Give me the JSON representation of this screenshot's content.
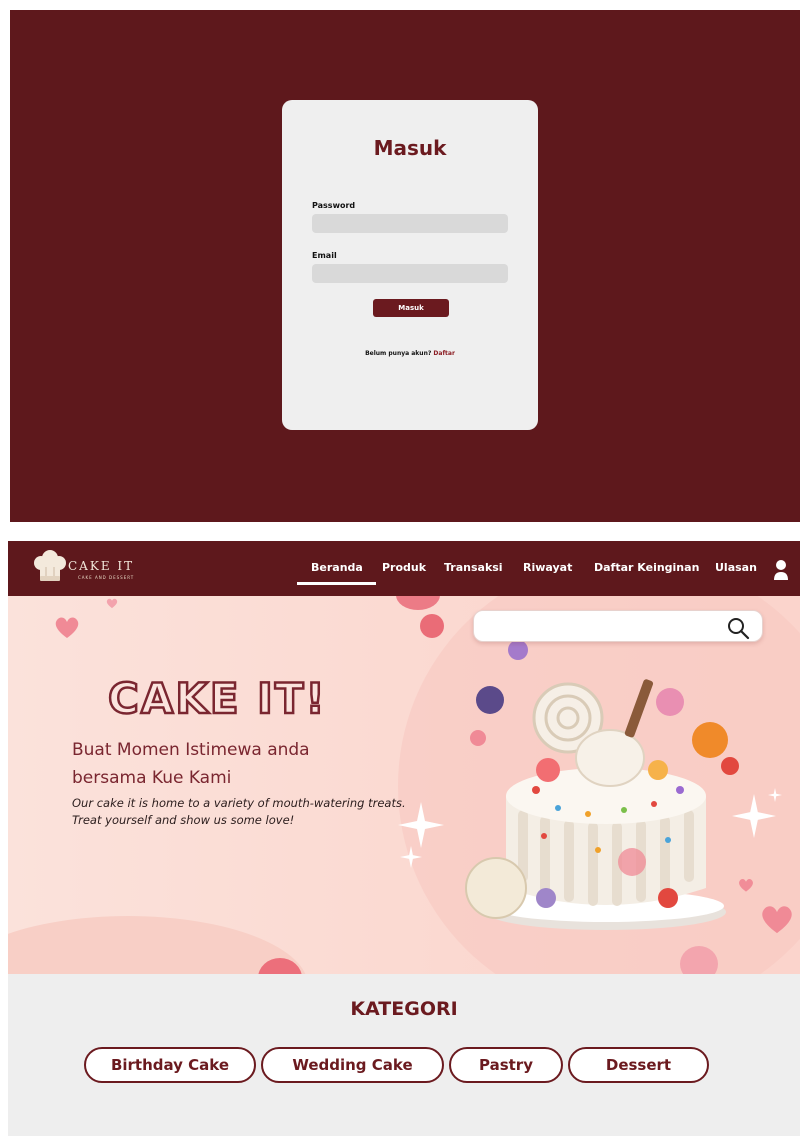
{
  "login": {
    "title": "Masuk",
    "password_label": "Password",
    "email_label": "Email",
    "submit_label": "Masuk",
    "register_prompt": "Belum punya akun?",
    "register_link": "Daftar"
  },
  "brand": {
    "logo_text": "CAKE IT",
    "logo_subtext": "CAKE AND DESSERT",
    "hero_brand": "CAKE IT!"
  },
  "nav": {
    "items": [
      "Beranda",
      "Produk",
      "Transaksi",
      "Riwayat",
      "Daftar Keinginan",
      "Ulasan"
    ],
    "active": "Beranda"
  },
  "hero": {
    "heading": "Buat Momen Istimewa anda bersama Kue Kami",
    "tagline": "Our cake it is home to a variety of mouth-watering treats. Treat yourself and show us some love!"
  },
  "search": {
    "placeholder": ""
  },
  "kategori": {
    "title": "KATEGORI",
    "items": [
      "Birthday Cake",
      "Wedding Cake",
      "Pastry",
      "Dessert"
    ]
  },
  "colors": {
    "maroon": "#5e181c",
    "accent": "#6b1a1f",
    "hero_bg": "#fbdad2",
    "card_bg": "#efefef",
    "input_bg": "#d9d9d9"
  },
  "icons": [
    "chef-hat-icon",
    "user-icon",
    "search-icon",
    "heart-icon",
    "sparkle-icon"
  ]
}
